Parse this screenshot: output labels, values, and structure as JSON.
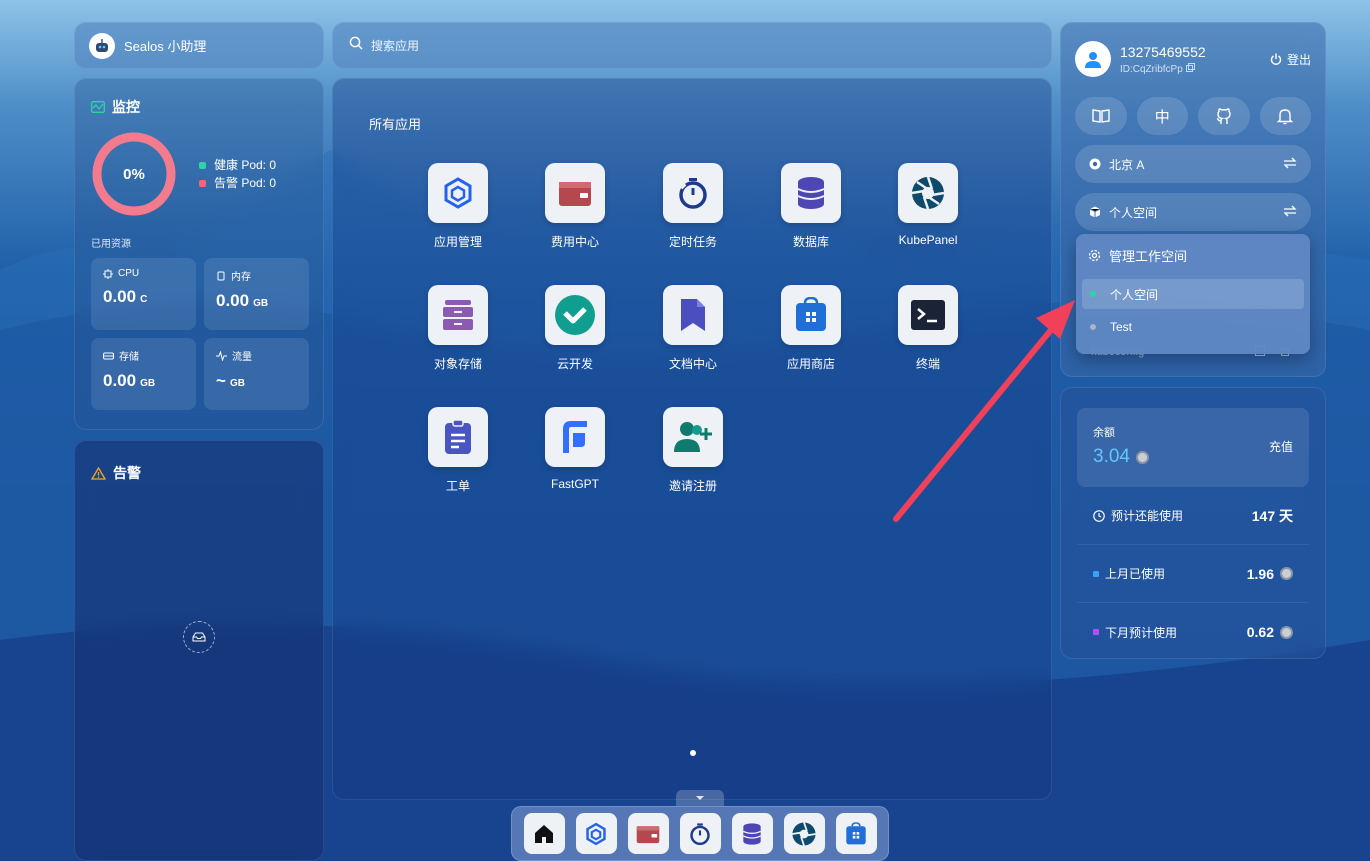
{
  "assistant": {
    "label": "Sealos 小助理",
    "icon": "robot-icon"
  },
  "search": {
    "placeholder": "搜索应用"
  },
  "monitor": {
    "title": "监控",
    "percent": "0%",
    "healthy_pods": "健康 Pod: 0",
    "alert_pods": "告警 Pod: 0",
    "used_label": "已用资源",
    "resources": [
      {
        "name": "CPU",
        "value": "0.00",
        "unit": "C",
        "icon": "cpu-icon"
      },
      {
        "name": "内存",
        "value": "0.00",
        "unit": "GB",
        "icon": "memory-icon"
      },
      {
        "name": "存储",
        "value": "0.00",
        "unit": "GB",
        "icon": "storage-icon"
      },
      {
        "name": "流量",
        "value": "~",
        "unit": "GB",
        "icon": "traffic-icon"
      }
    ],
    "colors": {
      "ring": "#f47b8e",
      "healthy": "#2ed3a8",
      "alert": "#f4667a"
    }
  },
  "alert": {
    "title": "告警"
  },
  "apps": {
    "heading": "所有应用",
    "items": [
      {
        "label": "应用管理",
        "icon": "app-management-icon"
      },
      {
        "label": "费用中心",
        "icon": "wallet-icon"
      },
      {
        "label": "定时任务",
        "icon": "timer-icon"
      },
      {
        "label": "数据库",
        "icon": "database-icon"
      },
      {
        "label": "KubePanel",
        "icon": "aperture-icon"
      },
      {
        "label": "对象存储",
        "icon": "object-storage-icon"
      },
      {
        "label": "云开发",
        "icon": "cloud-dev-icon"
      },
      {
        "label": "文档中心",
        "icon": "docs-icon"
      },
      {
        "label": "应用商店",
        "icon": "app-store-icon"
      },
      {
        "label": "终端",
        "icon": "terminal-icon"
      },
      {
        "label": "工单",
        "icon": "ticket-icon"
      },
      {
        "label": "FastGPT",
        "icon": "fastgpt-icon"
      },
      {
        "label": "邀请注册",
        "icon": "invite-icon"
      }
    ]
  },
  "dock": {
    "items": [
      "home-icon",
      "app-management-icon",
      "wallet-icon",
      "timer-icon",
      "database-icon",
      "aperture-icon",
      "app-store-icon"
    ]
  },
  "user": {
    "phone": "13275469552",
    "id": "ID:CqZribfcPp",
    "logout": "登出",
    "lang_label": "中",
    "region": "北京 A",
    "workspace": "个人空间",
    "kube_peek": "kubeconfig"
  },
  "workspace_menu": {
    "manage": "管理工作空间",
    "items": [
      {
        "label": "个人空间",
        "active": true
      },
      {
        "label": "Test",
        "active": false
      }
    ]
  },
  "balance": {
    "label": "余额",
    "value": "3.04",
    "charge": "充值",
    "stats": [
      {
        "label": "预计还能使用",
        "value": "147 天",
        "coin": false,
        "color": ""
      },
      {
        "label": "上月已使用",
        "value": "1.96",
        "coin": true,
        "color": "#3aa0ff"
      },
      {
        "label": "下月预计使用",
        "value": "0.62",
        "coin": true,
        "color": "#b34dff"
      }
    ]
  }
}
